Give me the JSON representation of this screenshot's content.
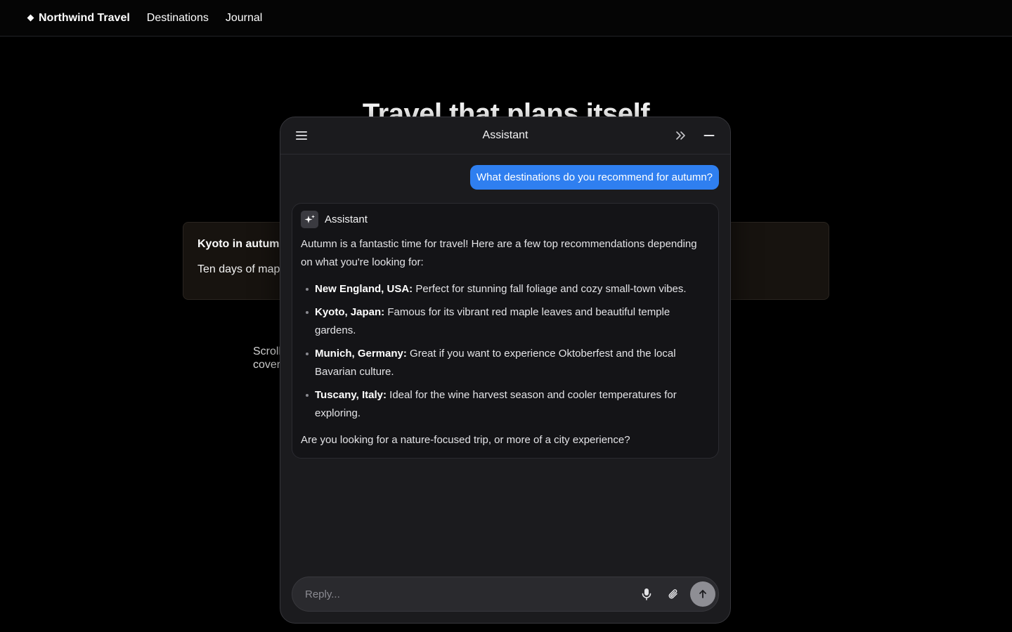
{
  "nav": {
    "brand": "Northwind Travel",
    "links": [
      "Destinations",
      "Journal"
    ]
  },
  "hero": {
    "title": "Travel that plans itself"
  },
  "story": {
    "title": "Kyoto in autumn",
    "body": "Ten days of maple"
  },
  "scroll_note": "Scroll cover",
  "assistant": {
    "title": "Assistant",
    "user_message": "What destinations do you recommend for autumn?",
    "reply_name": "Assistant",
    "intro": "Autumn is a fantastic time for travel! Here are a few top recommendations depending on what you're looking for:",
    "items": [
      {
        "place": "New England, USA:",
        "text": " Perfect for stunning fall foliage and cozy small-town vibes."
      },
      {
        "place": "Kyoto, Japan:",
        "text": " Famous for its vibrant red maple leaves and beautiful temple gardens."
      },
      {
        "place": "Munich, Germany:",
        "text": " Great if you want to experience Oktoberfest and the local Bavarian culture."
      },
      {
        "place": "Tuscany, Italy:",
        "text": " Ideal for the wine harvest season and cooler temperatures for exploring."
      }
    ],
    "outro": "Are you looking for a nature-focused trip, or more of a city experience?",
    "composer_placeholder": "Reply...",
    "icons": {
      "menu": "menu-icon",
      "expand": "double-chevron-right-icon",
      "minimize": "minus-icon",
      "sparkle": "sparkle-icon",
      "mic": "microphone-icon",
      "attach": "paperclip-icon",
      "send": "arrow-up-icon"
    }
  },
  "colors": {
    "accent": "#2f7ff0",
    "panel_bg": "#1b1b1e",
    "page_bg": "#000000"
  }
}
